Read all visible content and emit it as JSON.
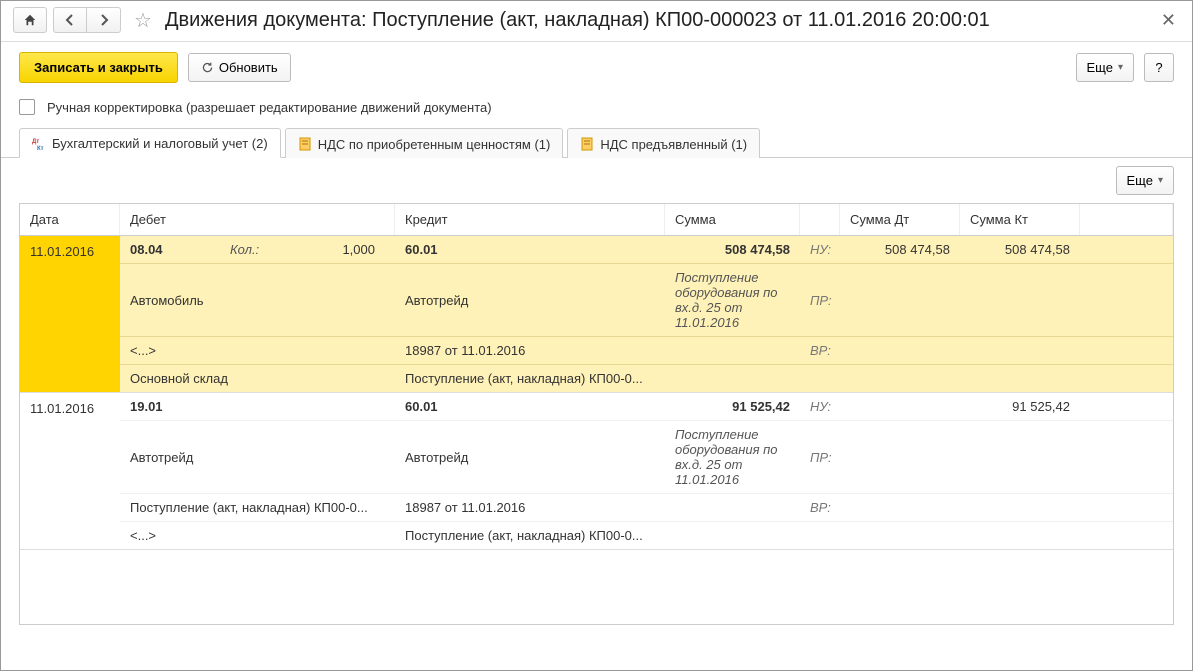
{
  "title": "Движения документа: Поступление (акт, накладная) КП00-000023 от 11.01.2016 20:00:01",
  "toolbar": {
    "save_close": "Записать и закрыть",
    "refresh": "Обновить",
    "more": "Еще",
    "help": "?"
  },
  "checkbox_label": "Ручная корректировка (разрешает редактирование движений документа)",
  "tabs": [
    {
      "label": "Бухгалтерский и налоговый учет (2)",
      "active": true,
      "icon": "dtkt"
    },
    {
      "label": "НДС по приобретенным ценностям (1)",
      "active": false,
      "icon": "doc"
    },
    {
      "label": "НДС предъявленный (1)",
      "active": false,
      "icon": "doc"
    }
  ],
  "inner_more": "Еще",
  "headers": {
    "date": "Дата",
    "debit": "Дебет",
    "credit": "Кредит",
    "sum": "Сумма",
    "sumdt": "Сумма Дт",
    "sumkt": "Сумма Кт"
  },
  "rows": [
    {
      "highlight": true,
      "date": "11.01.2016",
      "debit_acct": "08.04",
      "qty_label": "Кол.:",
      "qty": "1,000",
      "credit_acct": "60.01",
      "sum": "508 474,58",
      "track1": "НУ:",
      "sumdt": "508 474,58",
      "sumkt": "508 474,58",
      "debit_lines": [
        "Автомобиль",
        "<...>",
        "Основной склад"
      ],
      "credit_lines": [
        "Автотрейд",
        "18987 от 11.01.2016",
        "Поступление (акт, накладная) КП00-0..."
      ],
      "desc": "Поступление оборудования по вх.д. 25 от 11.01.2016",
      "track2": "ПР:",
      "track3": "ВР:"
    },
    {
      "highlight": false,
      "date": "11.01.2016",
      "debit_acct": "19.01",
      "qty_label": "",
      "qty": "",
      "credit_acct": "60.01",
      "sum": "91 525,42",
      "track1": "НУ:",
      "sumdt": "",
      "sumkt": "91 525,42",
      "debit_lines": [
        "Автотрейд",
        "Поступление (акт, накладная) КП00-0...",
        "<...>"
      ],
      "credit_lines": [
        "Автотрейд",
        "18987 от 11.01.2016",
        "Поступление (акт, накладная) КП00-0..."
      ],
      "desc": "Поступление оборудования по вх.д. 25 от 11.01.2016",
      "track2": "ПР:",
      "track3": "ВР:"
    }
  ]
}
